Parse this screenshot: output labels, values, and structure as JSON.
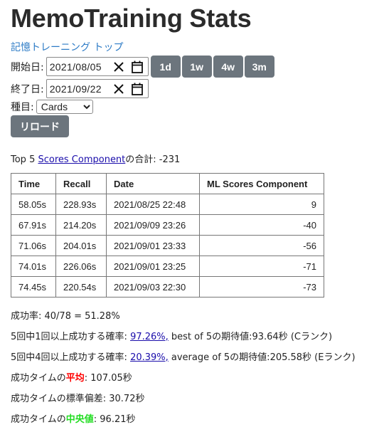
{
  "page": {
    "title": "MemoTraining Stats",
    "top_link": "記憶トレーニング トップ"
  },
  "filters": {
    "start_label": "開始日:",
    "start_date": "2021/08/05",
    "end_label": "終了日:",
    "end_date": "2021/09/22",
    "range_buttons": [
      "1d",
      "1w",
      "4w",
      "3m"
    ],
    "type_label": "種目:",
    "type_selected": "Cards",
    "reload_label": "リロード"
  },
  "summary": {
    "prefix": "Top 5 ",
    "link": "Scores Component",
    "suffix": "の合計: -231"
  },
  "table": {
    "headers": [
      "Time",
      "Recall",
      "Date",
      "ML Scores Component"
    ],
    "rows": [
      [
        "58.05s",
        "228.93s",
        "2021/08/25 22:48",
        "9"
      ],
      [
        "67.91s",
        "214.20s",
        "2021/09/09 23:26",
        "-40"
      ],
      [
        "71.06s",
        "204.01s",
        "2021/09/01 23:33",
        "-56"
      ],
      [
        "74.01s",
        "226.06s",
        "2021/09/01 23:25",
        "-71"
      ],
      [
        "74.45s",
        "220.54s",
        "2021/09/03 22:30",
        "-73"
      ]
    ]
  },
  "stats": {
    "success_rate": "成功率: 40/78 = 51.28%",
    "best5_prefix": "5回中1回以上成功する確率: ",
    "best5_link": "97.26%,",
    "best5_suffix": " best of 5の期待値:93.64秒 (Cランク)",
    "avg5_prefix": "5回中4回以上成功する確率: ",
    "avg5_link": "20.39%,",
    "avg5_suffix": " average of 5の期待値:205.58秒 (Eランク)",
    "mean_prefix": "成功タイムの",
    "mean_word": "平均",
    "mean_suffix": ": 107.05秒",
    "stddev": "成功タイムの標準偏差: 30.72秒",
    "median_prefix": "成功タイムの",
    "median_word": "中央値",
    "median_suffix": ": 96.21秒"
  }
}
